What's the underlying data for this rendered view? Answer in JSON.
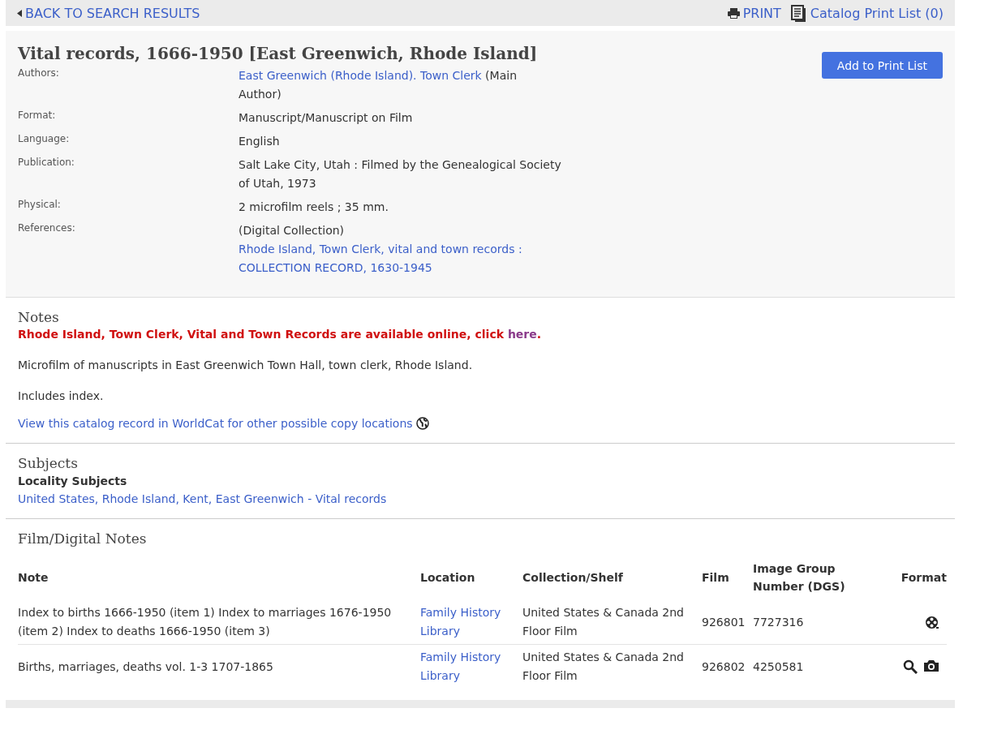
{
  "top_bar": {
    "back_link": "BACK TO SEARCH RESULTS",
    "print_link": "PRINT",
    "print_list_link": "Catalog Print List (0)"
  },
  "record": {
    "title": "Vital records, 1666-1950 [East Greenwich, Rhode Island]",
    "add_button": "Add to Print List",
    "fields": [
      {
        "label": "Authors:",
        "link": "East Greenwich (Rhode Island). Town Clerk",
        "after": " (Main Author)"
      },
      {
        "label": "Format:",
        "text": "Manuscript/Manuscript on Film"
      },
      {
        "label": "Language:",
        "text": "English"
      },
      {
        "label": "Publication:",
        "text": "Salt Lake City, Utah : Filmed by the Genealogical Society of Utah, 1973"
      },
      {
        "label": "Physical:",
        "text": "2 microfilm reels ; 35 mm."
      },
      {
        "label": "References:",
        "text": "(Digital Collection) ",
        "link": "Rhode Island, Town Clerk, vital and town records : COLLECTION RECORD, 1630-1945"
      }
    ]
  },
  "notes": {
    "heading": "Notes",
    "alert": {
      "text": "Rhode Island, Town Clerk, Vital and Town Records are available online, click ",
      "link": "here",
      "after": "."
    },
    "paragraphs": [
      "Microfilm of manuscripts in East Greenwich Town Hall, town clerk, Rhode Island.",
      "Includes index."
    ],
    "worldcat_link": "View this catalog record in WorldCat for other possible copy locations"
  },
  "subjects": {
    "heading": "Subjects",
    "subheading": "Locality Subjects",
    "links": [
      "United States, Rhode Island, Kent, East Greenwich - Vital records"
    ]
  },
  "film_notes": {
    "heading": "Film/Digital Notes",
    "columns": [
      "Note",
      "Location",
      "Collection/Shelf",
      "Film",
      "Image Group Number (DGS)",
      "Format"
    ],
    "rows": [
      {
        "note": "Index to births 1666-1950 (item 1) Index to marriages 1676-1950 (item 2) Index to deaths 1666-1950 (item 3)",
        "location": "Family History Library",
        "shelf": "United States & Canada 2nd Floor Film",
        "film": "926801",
        "dgs": "7727316",
        "formats": [
          {
            "kind": "film"
          }
        ]
      },
      {
        "note": "Births, marriages, deaths vol. 1-3 1707-1865",
        "location": "Family History Library",
        "shelf": "United States & Canada 2nd Floor Film",
        "film": "926802",
        "dgs": "4250581",
        "formats": [
          {
            "kind": "search"
          },
          {
            "kind": "camera"
          }
        ]
      }
    ]
  }
}
